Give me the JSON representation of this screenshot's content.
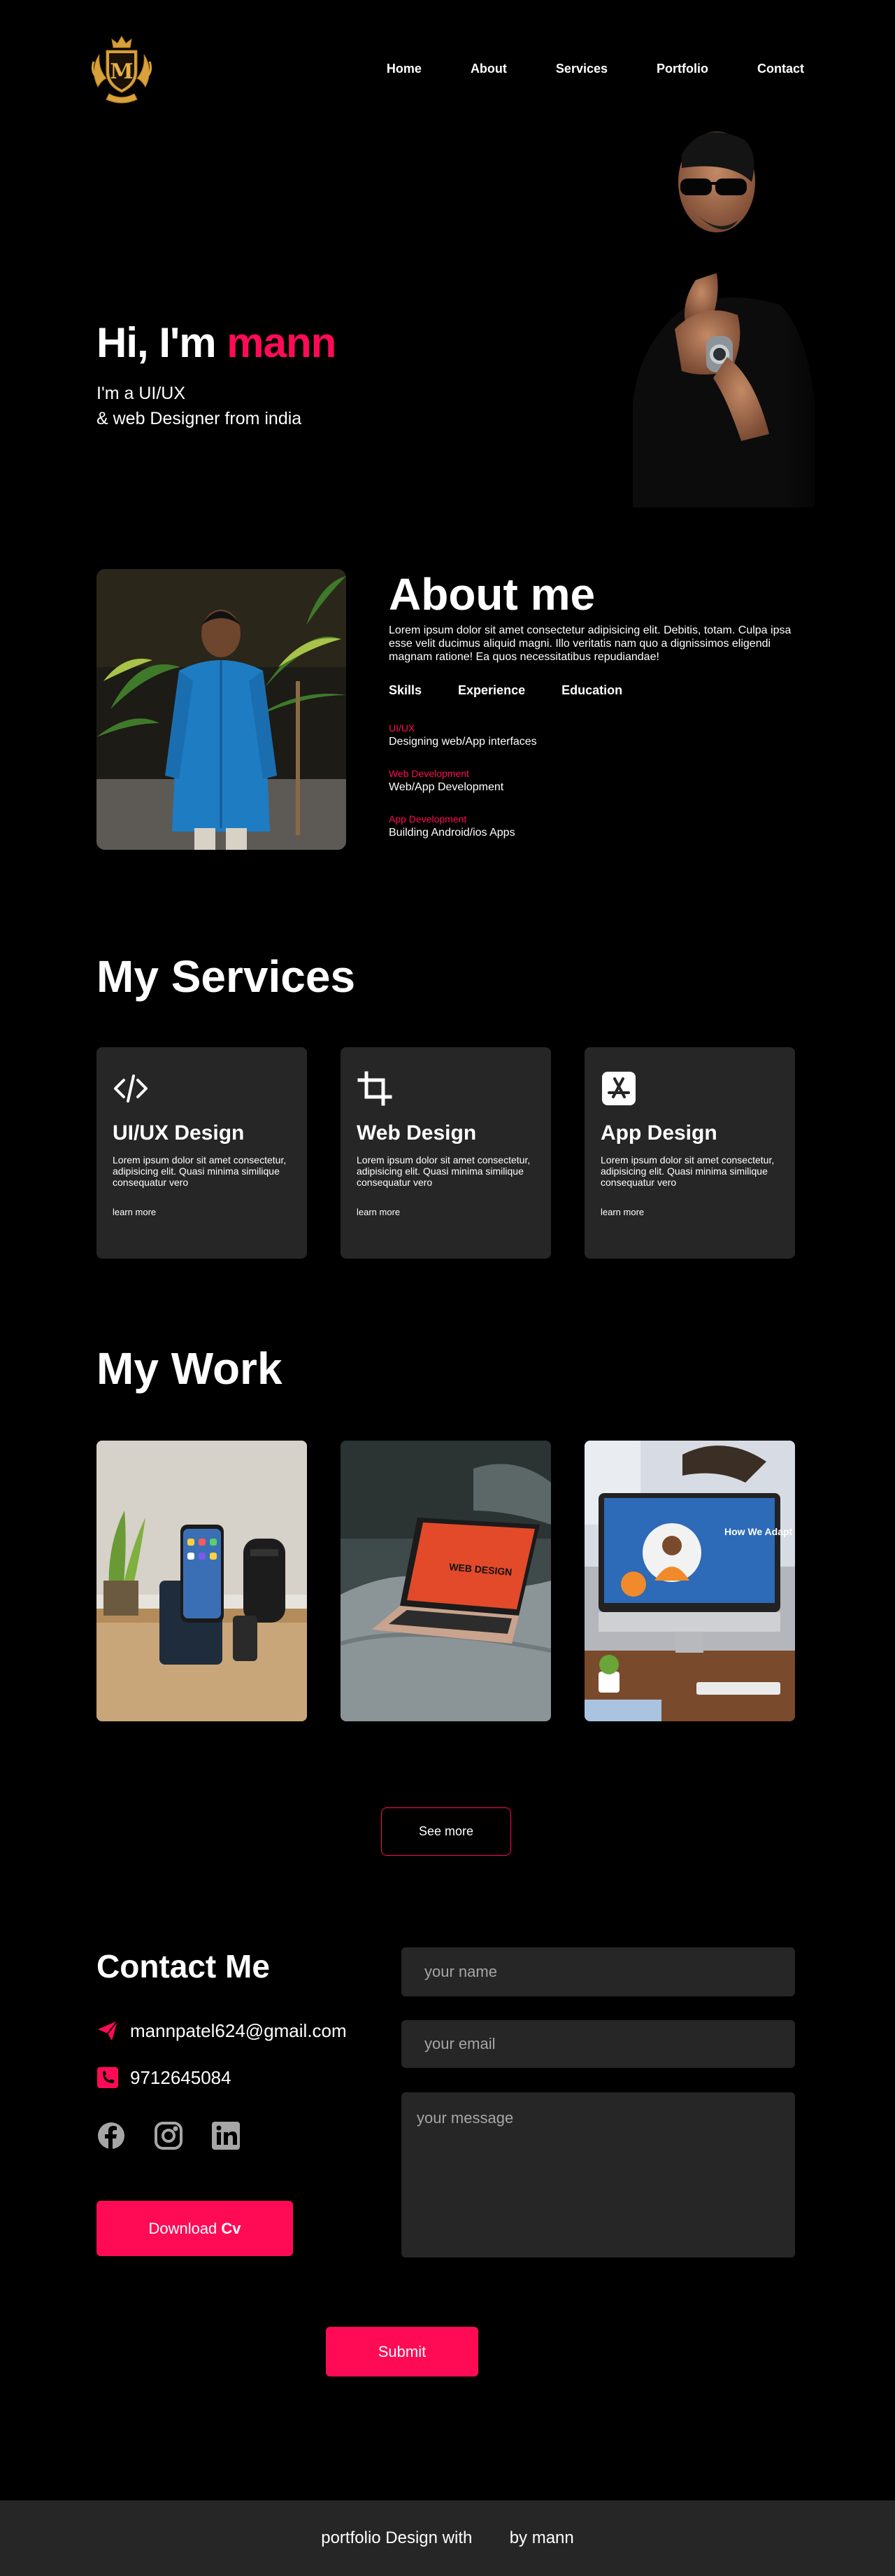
{
  "nav": {
    "logo_letter": "M",
    "links": [
      "Home",
      "About",
      "Services",
      "Portfolio",
      "Contact"
    ]
  },
  "hero": {
    "greeting": "Hi, I'm ",
    "name": "mann",
    "subtitle_line1": "I'm a UI/UX",
    "subtitle_line2": "& web Designer from india"
  },
  "about": {
    "title": "About me",
    "text": "Lorem ipsum dolor sit amet consectetur adipisicing elit. Debitis, totam. Culpa  ipsa esse velit ducimus aliquid magni. Illo veritatis nam quo a dignissimos eligendi magnam ratione! Ea quos necessitatibus repudiandae!",
    "tabs": [
      "Skills",
      "Experience",
      "Education"
    ],
    "skills": [
      {
        "category": "UI/UX",
        "desc": "Designing web/App interfaces"
      },
      {
        "category": "Web Development",
        "desc": "Web/App Development"
      },
      {
        "category": "App Development",
        "desc": "Building Android/ios Apps"
      }
    ]
  },
  "services": {
    "title": "My Services",
    "cards": [
      {
        "icon": "code-icon",
        "title": "UI/UX Design",
        "text": "Lorem ipsum dolor sit amet consectetur, adipisicing elit. Quasi minima similique consequatur vero",
        "link": "learn more"
      },
      {
        "icon": "crop-icon",
        "title": "Web Design",
        "text": "Lorem ipsum dolor sit amet consectetur, adipisicing elit. Quasi minima similique consequatur vero",
        "link": "learn more"
      },
      {
        "icon": "app-store-icon",
        "title": "App Design",
        "text": "Lorem ipsum dolor sit amet consectetur, adipisicing elit. Quasi minima similique consequatur vero",
        "link": "learn more"
      }
    ]
  },
  "work": {
    "title": "My Work",
    "laptop_screen_text": "WEB DESIGN",
    "monitor_screen_text": "How We Adapt",
    "see_more": "See more"
  },
  "contact": {
    "title": "Contact Me",
    "email": "mannpatel624@gmail.com",
    "phone": "9712645084",
    "download_label": "Download",
    "download_label_bold": "Cv",
    "name_placeholder": "your name",
    "email_placeholder": "your email",
    "message_placeholder": "your message",
    "submit_label": "Submit"
  },
  "footer": {
    "text_before": "portfolio Design with",
    "text_after": "by mann"
  },
  "colors": {
    "accent": "#ff0b55",
    "card": "#262626",
    "background": "#000000"
  }
}
